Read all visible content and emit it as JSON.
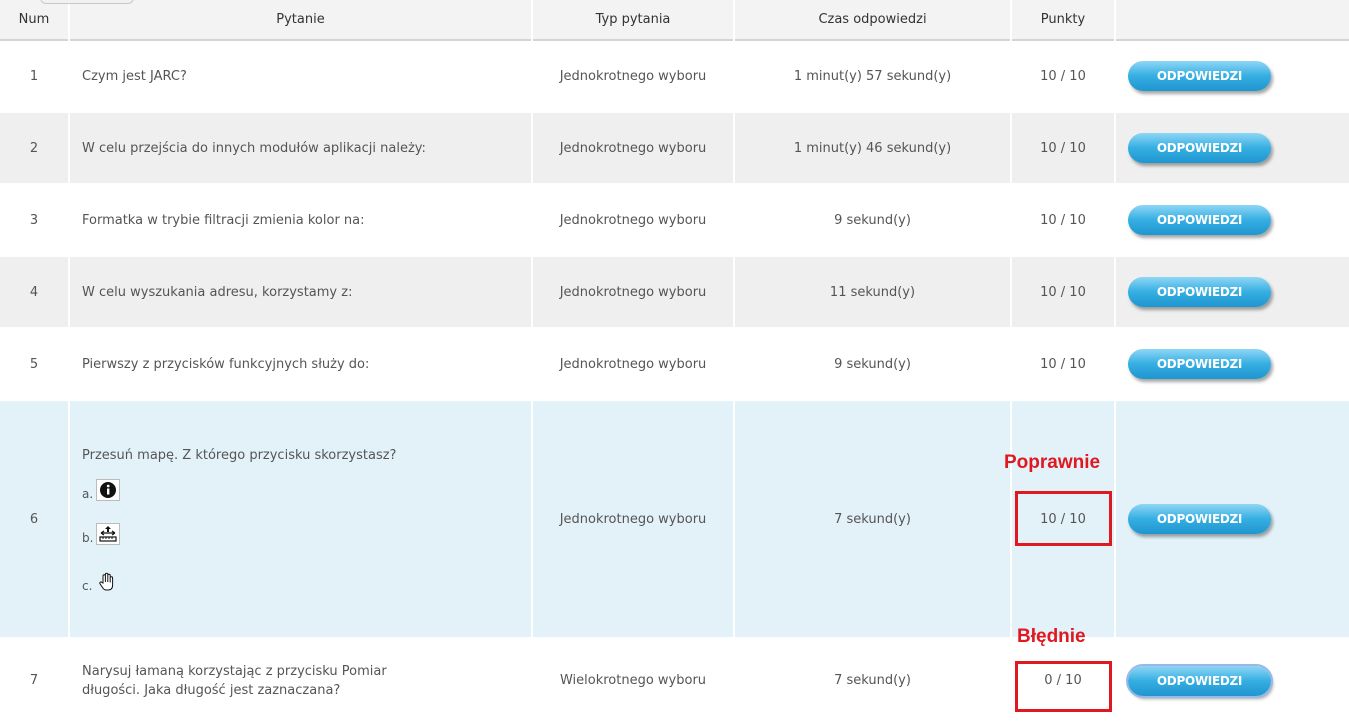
{
  "header": {
    "num": "Num",
    "question": "Pytanie",
    "type": "Typ pytania",
    "time": "Czas odpowiedzi",
    "points": "Punkty"
  },
  "rows": [
    {
      "num": "1",
      "question": "Czym jest JARC?",
      "type": "Jednokrotnego wyboru",
      "time": "1 minut(y) 57 sekund(y)",
      "points": "10 / 10",
      "button": "ODPOWIEDZI"
    },
    {
      "num": "2",
      "question": "W celu przejścia do innych modułów aplikacji należy:",
      "type": "Jednokrotnego wyboru",
      "time": "1 minut(y) 46 sekund(y)",
      "points": "10 / 10",
      "button": "ODPOWIEDZI"
    },
    {
      "num": "3",
      "question": "Formatka w trybie filtracji zmienia kolor na:",
      "type": "Jednokrotnego wyboru",
      "time": "9 sekund(y)",
      "points": "10 / 10",
      "button": "ODPOWIEDZI"
    },
    {
      "num": "4",
      "question": "W celu wyszukania adresu, korzystamy z:",
      "type": "Jednokrotnego wyboru",
      "time": "11 sekund(y)",
      "points": "10 / 10",
      "button": "ODPOWIEDZI"
    },
    {
      "num": "5",
      "question": "Pierwszy z przycisków funkcyjnych służy do:",
      "type": "Jednokrotnego wyboru",
      "time": "9 sekund(y)",
      "points": "10 / 10",
      "button": "ODPOWIEDZI"
    },
    {
      "num": "6",
      "question": "Przesuń mapę. Z którego przycisku skorzystasz?",
      "options": [
        {
          "label": "a.",
          "icon": "info-icon"
        },
        {
          "label": "b.",
          "icon": "measure-icon"
        },
        {
          "label": "c.",
          "icon": "hand-pan-icon"
        }
      ],
      "type": "Jednokrotnego wyboru",
      "time": "7 sekund(y)",
      "points": "10 / 10",
      "button": "ODPOWIEDZI"
    },
    {
      "num": "7",
      "question": "Narysuj łamaną korzystając z przycisku Pomiar długości. Jaka długość jest zaznaczana?",
      "type": "Wielokrotnego wyboru",
      "time": "7 sekund(y)",
      "points": "0 / 10",
      "button": "ODPOWIEDZI"
    }
  ],
  "annotations": {
    "correct": "Poprawnie",
    "wrong": "Błędnie"
  },
  "colors": {
    "button": "#35aee2",
    "annotation": "#e01820",
    "row_alt": "#efefef",
    "row_highlight": "#e3f2f9"
  }
}
